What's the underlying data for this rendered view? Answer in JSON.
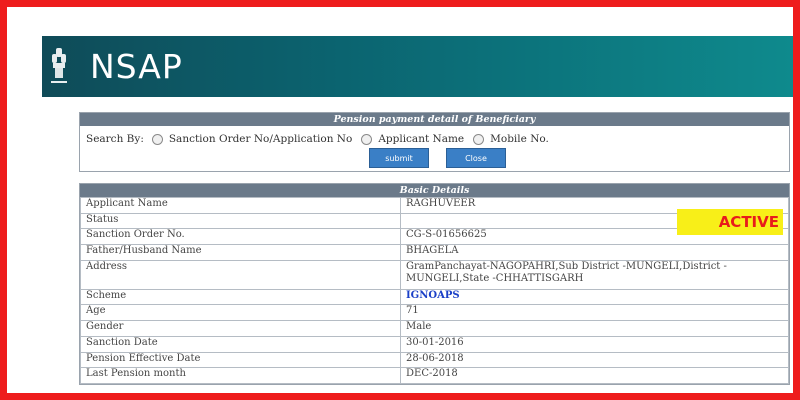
{
  "header": {
    "logo_text": "NSAP",
    "emblem_icon": "ashoka-emblem-icon"
  },
  "search_panel": {
    "title": "Pension payment detail of Beneficiary",
    "search_by_label": "Search By:",
    "options": [
      "Sanction Order No/Application No",
      "Applicant Name",
      "Mobile No."
    ],
    "submit_label": "submit",
    "close_label": "Close"
  },
  "details": {
    "title": "Basic Details",
    "rows": [
      {
        "label": "Applicant Name",
        "value": "RAGHUVEER"
      },
      {
        "label": "Status",
        "value": "ACTIVE"
      },
      {
        "label": "Sanction Order No.",
        "value": "CG-S-01656625"
      },
      {
        "label": "Father/Husband Name",
        "value": "BHAGELA"
      },
      {
        "label": "Address",
        "value": "GramPanchayat-NAGOPAHRI,Sub District -MUNGELI,District -MUNGELI,State -CHHATTISGARH"
      },
      {
        "label": "Scheme",
        "value": "IGNOAPS"
      },
      {
        "label": "Age",
        "value": "71"
      },
      {
        "label": "Gender",
        "value": "Male"
      },
      {
        "label": "Sanction Date",
        "value": "30-01-2016"
      },
      {
        "label": "Pension Effective Date",
        "value": "28-06-2018"
      },
      {
        "label": "Last Pension month",
        "value": "DEC-2018"
      }
    ]
  },
  "colors": {
    "frame": "#ee1c1c",
    "header_start": "#0f4b58",
    "header_end": "#0e8a8d",
    "status_bg": "#f8ef18",
    "status_text": "#e81b1b",
    "button": "#3a7fc6"
  }
}
